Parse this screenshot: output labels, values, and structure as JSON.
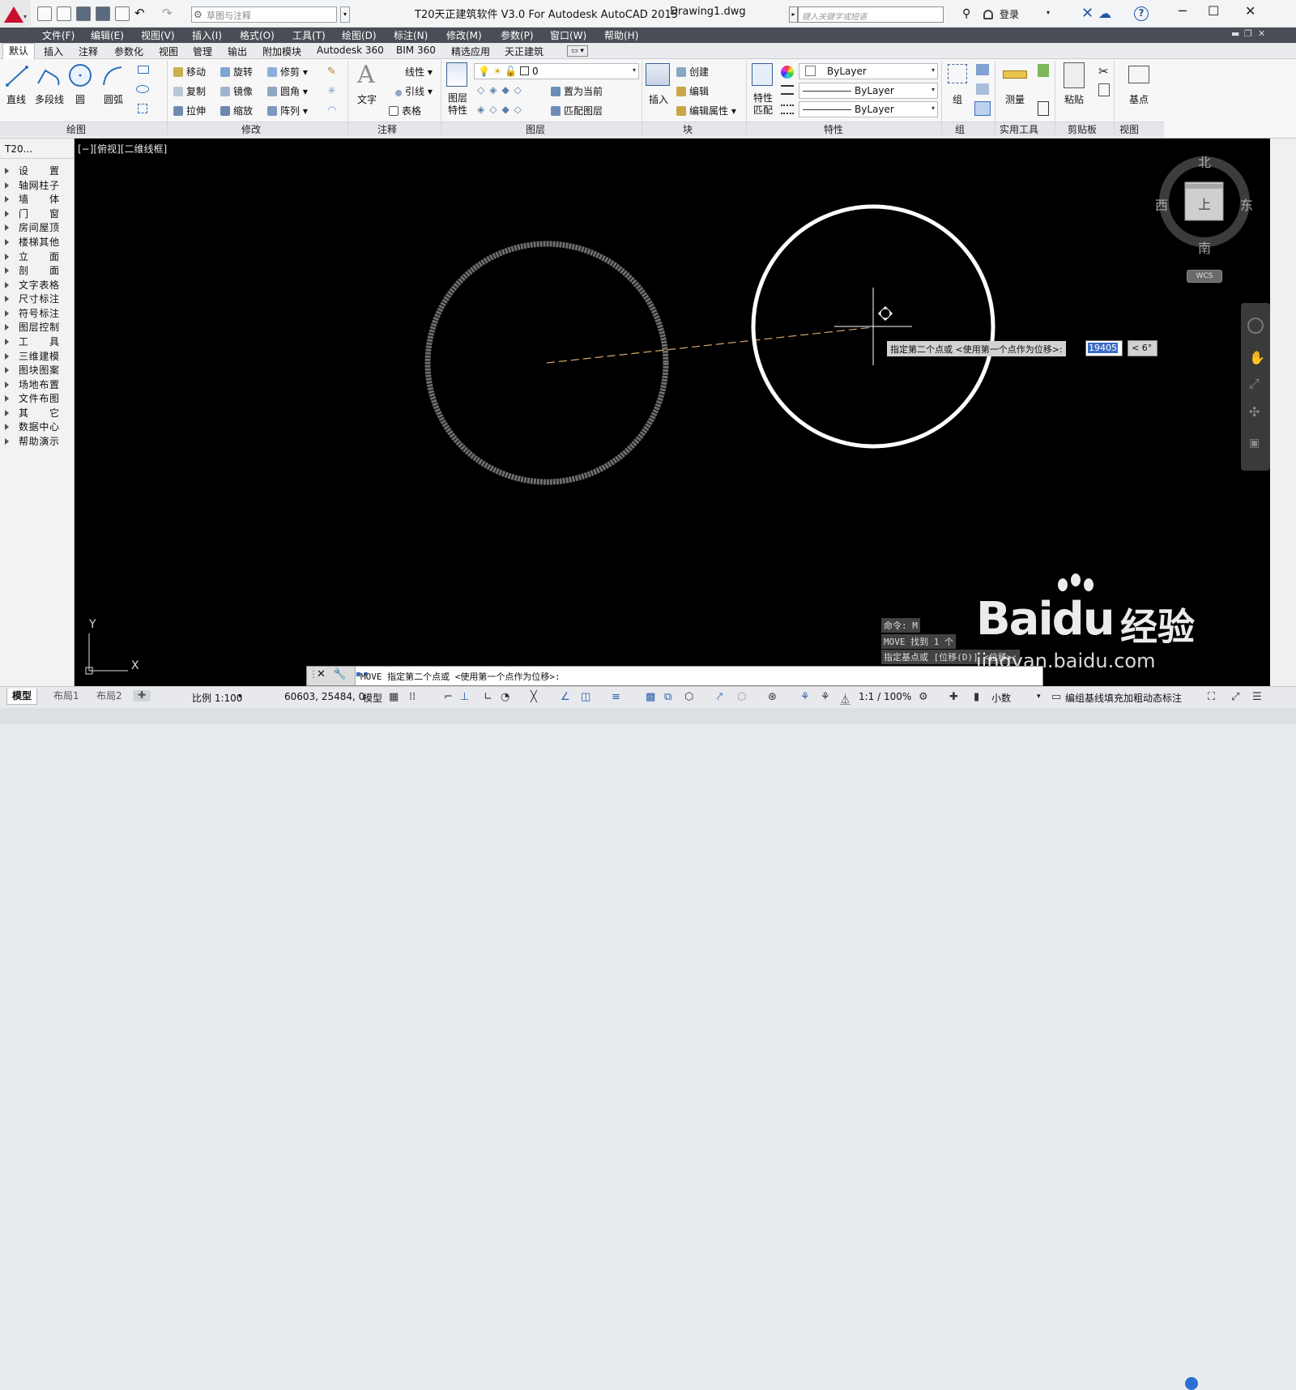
{
  "titlebar": {
    "workspace": "草图与注释",
    "app_title": "T20天正建筑软件 V3.0 For Autodesk AutoCAD 2015",
    "document": "Drawing1.dwg",
    "search_placeholder": "键入关键字或短语",
    "login": "登录",
    "window_min": "─",
    "window_max": "☐",
    "window_close": "✕"
  },
  "menu": [
    "文件(F)",
    "编辑(E)",
    "视图(V)",
    "插入(I)",
    "格式(O)",
    "工具(T)",
    "绘图(D)",
    "标注(N)",
    "修改(M)",
    "参数(P)",
    "窗口(W)",
    "帮助(H)"
  ],
  "tabs": [
    "默认",
    "插入",
    "注释",
    "参数化",
    "视图",
    "管理",
    "输出",
    "附加模块",
    "Autodesk 360",
    "BIM 360",
    "精选应用",
    "天正建筑"
  ],
  "ribbon": {
    "draw": {
      "line": "直线",
      "polyline": "多段线",
      "circle": "圆",
      "arc": "圆弧",
      "title": "绘图"
    },
    "modify": {
      "move": "移动",
      "rotate": "旋转",
      "trim": "修剪",
      "copy": "复制",
      "mirror": "镜像",
      "fillet": "圆角",
      "stretch": "拉伸",
      "scale": "缩放",
      "array": "阵列",
      "title": "修改"
    },
    "annotation": {
      "text": "文字",
      "linear": "线性",
      "leader": "引线",
      "table": "表格",
      "title": "注释"
    },
    "layers": {
      "properties": "图层特性",
      "layer_value": "0",
      "set_current": "置为当前",
      "match_layer": "匹配图层",
      "title": "图层"
    },
    "block": {
      "insert": "插入",
      "create": "创建",
      "edit": "编辑",
      "edit_attr": "编辑属性",
      "title": "块"
    },
    "properties": {
      "match": "特性匹配",
      "color": "ByLayer",
      "linetype": "ByLayer",
      "lineweight": "ByLayer",
      "title": "特性"
    },
    "groups": {
      "group": "组",
      "title": "组"
    },
    "utilities": {
      "measure": "测量",
      "title": "实用工具"
    },
    "clipboard": {
      "paste": "粘贴",
      "title": "剪贴板"
    },
    "view": {
      "base": "基点",
      "title": "视图"
    }
  },
  "palette": {
    "title": "T20...",
    "items": [
      "设　置",
      "轴网柱子",
      "墙　体",
      "门　窗",
      "房间屋顶",
      "楼梯其他",
      "立　面",
      "剖　面",
      "文字表格",
      "尺寸标注",
      "符号标注",
      "图层控制",
      "工　具",
      "三维建模",
      "图块图案",
      "场地布置",
      "文件布图",
      "其　它",
      "数据中心",
      "帮助演示"
    ]
  },
  "canvas": {
    "viewport_label": "[−][俯视][二维线框]",
    "compass": {
      "north": "北",
      "south": "南",
      "east": "东",
      "west": "西",
      "top": "上",
      "wcs": "WCS"
    },
    "ucs": {
      "x": "X",
      "y": "Y"
    },
    "dynamic_prompt": "指定第二个点或 <使用第一个点作为位移>:",
    "dynamic_value": "19405",
    "dynamic_angle": "< 6°",
    "history": [
      "命令: M",
      "MOVE 找到 1 个",
      "指定基点或 [位移(D)] <位移>:"
    ]
  },
  "command_line": "MOVE 指定第二个点或 <使用第一个点作为位移>:",
  "statusbar": {
    "layouts": [
      "模型",
      "布局1",
      "布局2"
    ],
    "scale": "比例 1:100",
    "coords": "60603, 25484, 0",
    "model": "模型",
    "annoscale": "1:1 / 100%",
    "units": "小数",
    "tianzheng": "编组基线填充加粗动态标注"
  },
  "watermark": {
    "brand": "Baidu",
    "cn": "经验",
    "url": "jingyan.baidu.com"
  },
  "colors": {
    "canvas": "#000000",
    "menubar": "#4a4d55",
    "accent": "#3b6cc7",
    "logo": "#c8102e"
  }
}
